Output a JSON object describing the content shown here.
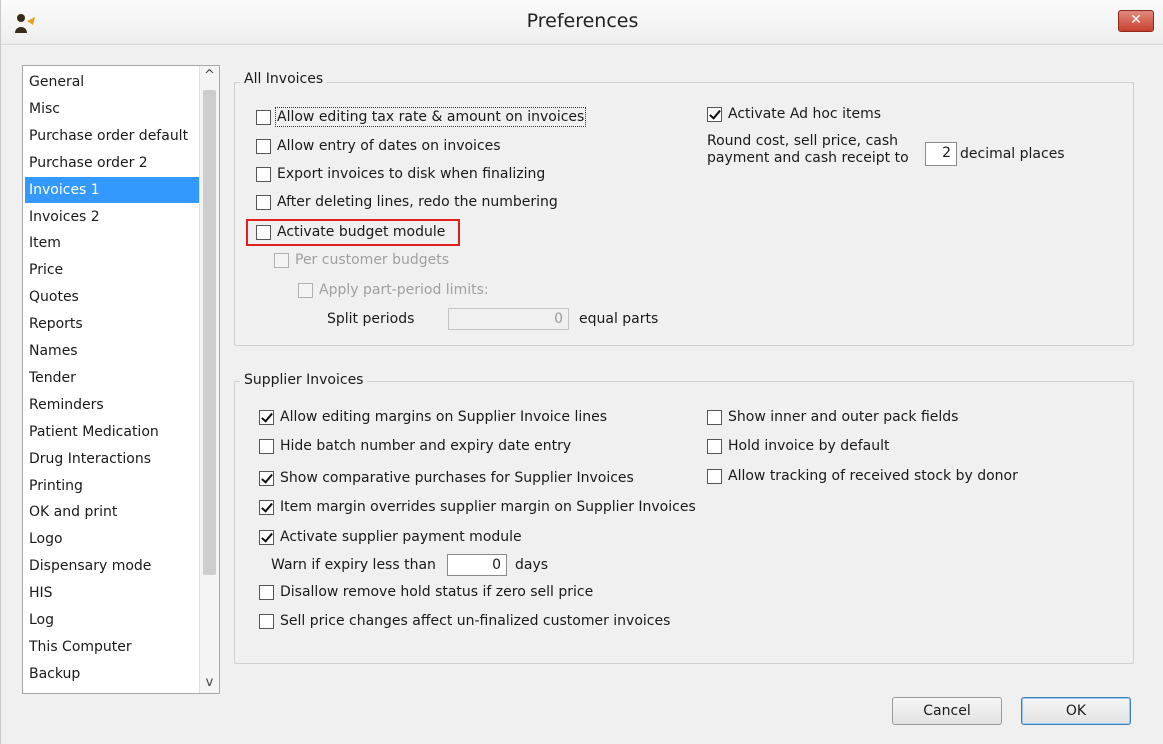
{
  "window": {
    "title": "Preferences",
    "close_label": "✕"
  },
  "nav": {
    "items": [
      "General",
      "Misc",
      "Purchase order default",
      "Purchase order 2",
      "Invoices 1",
      "Invoices 2",
      "Item",
      "Price",
      "Quotes",
      "Reports",
      "Names",
      "Tender",
      "Reminders",
      "Patient Medication",
      "Drug Interactions",
      "Printing",
      "OK and print",
      "Logo",
      "Dispensary mode",
      "HIS",
      "Log",
      "This Computer",
      "Backup"
    ],
    "selected": "Invoices 1",
    "scroll_up": "^",
    "scroll_down": "v"
  },
  "all_invoices": {
    "title": "All Invoices",
    "allow_edit_tax": {
      "label": "Allow editing tax rate & amount on invoices",
      "checked": false
    },
    "allow_entry_dates": {
      "label": "Allow entry of dates on invoices",
      "checked": false
    },
    "export_invoices": {
      "label": "Export invoices to disk when finalizing",
      "checked": false
    },
    "redo_numbering": {
      "label": "After deleting lines, redo the numbering",
      "checked": false
    },
    "activate_budget": {
      "label": "Activate budget module",
      "checked": false
    },
    "per_customer_budgets": {
      "label": "Per customer budgets",
      "checked": false
    },
    "apply_part_period": {
      "label": "Apply part-period limits:",
      "checked": false
    },
    "split_periods_label": "Split periods",
    "split_periods_value": "0",
    "equal_parts_label": "equal parts",
    "activate_adhoc": {
      "label": "Activate Ad hoc items",
      "checked": true
    },
    "round_label_line1": "Round cost, sell price, cash",
    "round_label_line2": "payment and cash receipt to",
    "decimal_value": "2",
    "decimal_label": "decimal places"
  },
  "supplier_invoices": {
    "title": "Supplier Invoices",
    "allow_edit_margins": {
      "label": "Allow editing margins on Supplier Invoice lines",
      "checked": true
    },
    "hide_batch": {
      "label": "Hide batch number and expiry date entry",
      "checked": false
    },
    "show_comparative": {
      "label": "Show comparative purchases for Supplier Invoices",
      "checked": true
    },
    "item_margin_overrides": {
      "label": "Item margin overrides supplier margin on Supplier Invoices",
      "checked": true
    },
    "activate_supplier_payment": {
      "label": "Activate supplier payment module",
      "checked": true
    },
    "warn_expiry_label": "Warn if expiry less than",
    "warn_expiry_value": "0",
    "days_label": "days",
    "disallow_remove_hold": {
      "label": "Disallow remove hold status if zero sell price",
      "checked": false
    },
    "sell_price_changes": {
      "label": "Sell price changes affect un-finalized customer invoices",
      "checked": false
    },
    "show_inner_outer": {
      "label": "Show inner and outer pack fields",
      "checked": false
    },
    "hold_invoice": {
      "label": "Hold invoice by default",
      "checked": false
    },
    "allow_tracking_donor": {
      "label": "Allow tracking of received stock by donor",
      "checked": false
    }
  },
  "buttons": {
    "cancel": "Cancel",
    "ok": "OK"
  }
}
